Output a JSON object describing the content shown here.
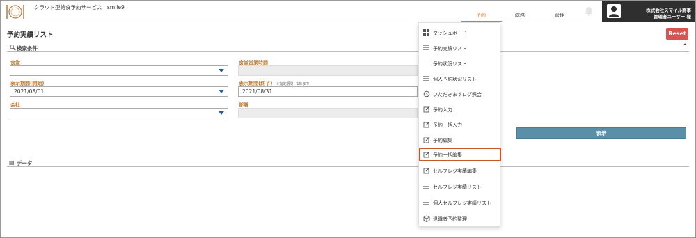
{
  "app": {
    "title": "クラウド型給食予約サービス　smile9",
    "logo_icon": "fork-plate-logo"
  },
  "nav": {
    "tabs": [
      {
        "label": "予約",
        "active": true
      },
      {
        "label": "総務",
        "active": false
      },
      {
        "label": "管理",
        "active": false
      }
    ]
  },
  "user": {
    "company": "株式会社スマイル商事",
    "name": "管理者ユーザー 様"
  },
  "page": {
    "title": "予約実績リスト",
    "reset_label": "Reset",
    "search_section": "検索条件",
    "data_section": "データ",
    "show_button": "表示"
  },
  "form": {
    "cafeteria_label": "食堂",
    "cafeteria_value": "",
    "hours_label": "食堂営業時間",
    "start_label": "表示期間(開始)",
    "start_value": "2021/08/01",
    "end_label": "表示期間(終了)",
    "end_note": "※指定期間：1年まで",
    "end_value": "2021/08/31",
    "company_label": "会社",
    "company_value": "",
    "dept_label": "部署"
  },
  "dropdown": {
    "items": [
      {
        "label": "ダッシュボード",
        "icon": "dashboard-icon"
      },
      {
        "label": "予約実績リスト",
        "icon": "list-icon"
      },
      {
        "label": "予約状況リスト",
        "icon": "list-icon"
      },
      {
        "label": "個人予約状況リスト",
        "icon": "list-icon"
      },
      {
        "label": "いただきますログ照会",
        "icon": "history-icon"
      },
      {
        "label": "予約入力",
        "icon": "edit-icon"
      },
      {
        "label": "予約一括入力",
        "icon": "edit-icon"
      },
      {
        "label": "予約編集",
        "icon": "edit-icon"
      },
      {
        "label": "予約一括編集",
        "icon": "edit-icon",
        "highlighted": true
      },
      {
        "label": "セルフレジ実績編集",
        "icon": "edit-icon"
      },
      {
        "label": "セルフレジ実績リスト",
        "icon": "list-icon"
      },
      {
        "label": "個人セルフレジ実績リスト",
        "icon": "list-icon"
      },
      {
        "label": "退職者予約整理",
        "icon": "box-icon"
      }
    ]
  },
  "colors": {
    "accent": "#e07a2a",
    "label": "#c0782e",
    "reset": "#d9534f",
    "show_button": "#5a8fa8",
    "user_bar": "#2f2f2f",
    "highlight_border": "#c8562a"
  }
}
